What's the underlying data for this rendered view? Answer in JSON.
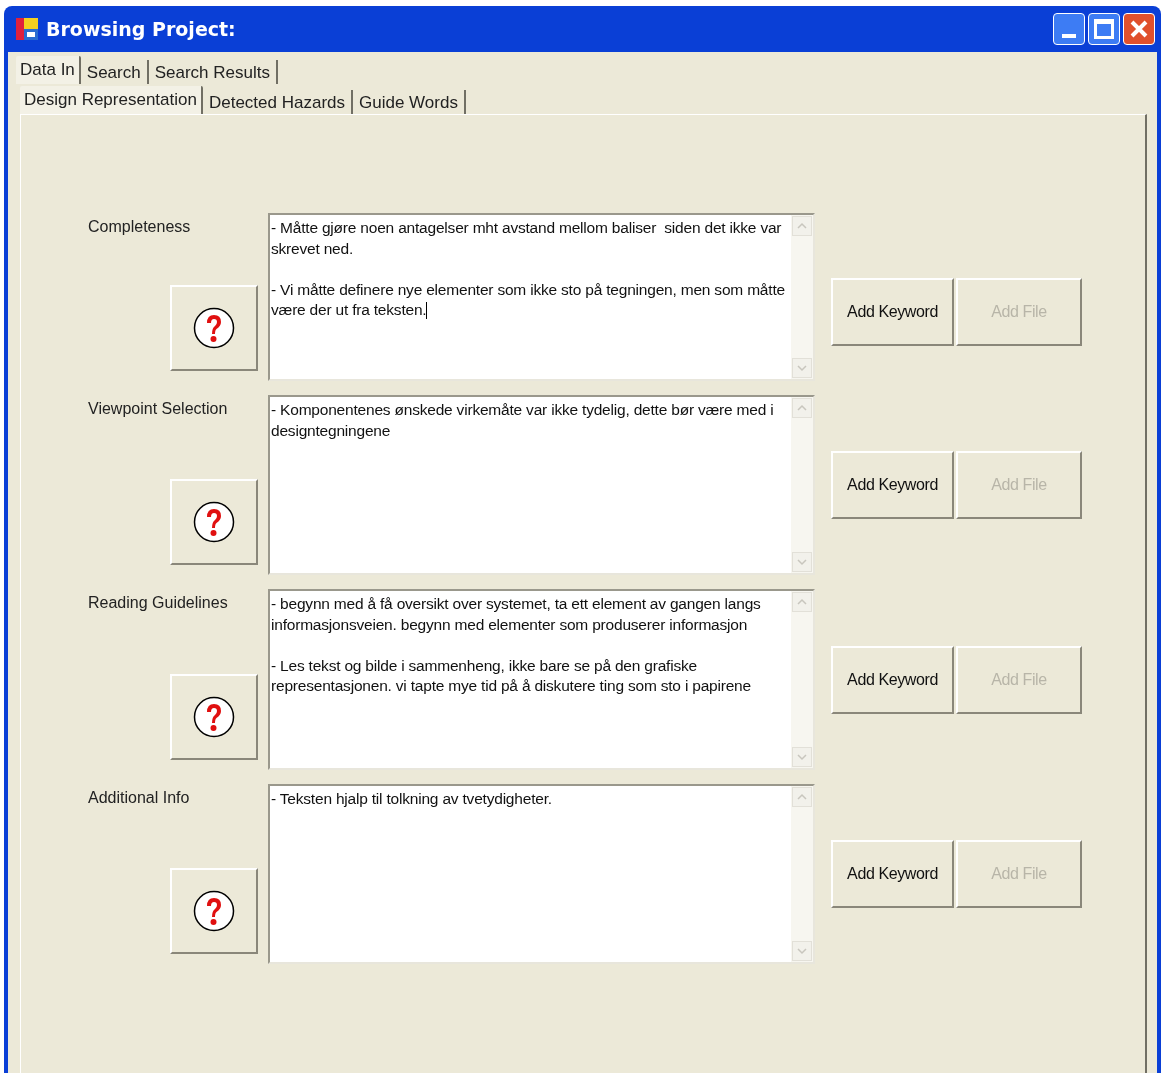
{
  "window": {
    "title": "Browsing Project:"
  },
  "tabs": [
    {
      "label": "Data In",
      "selected": true
    },
    {
      "label": "Search",
      "selected": false
    },
    {
      "label": "Search Results",
      "selected": false
    }
  ],
  "subtabs": [
    {
      "label": "Design Representation",
      "selected": true
    },
    {
      "label": "Detected Hazards",
      "selected": false
    },
    {
      "label": "Guide Words",
      "selected": false
    }
  ],
  "sections": [
    {
      "label": "Completeness",
      "text": "- Måtte gjøre noen antagelser mht avstand mellom baliser  siden det ikke var skrevet ned.\n\n- Vi måtte definere nye elementer som ikke sto på tegningen, men som måtte være der ut fra teksten.",
      "focused": true,
      "buttons": [
        {
          "label": "Add Keyword",
          "disabled": false
        },
        {
          "label": "Add File",
          "disabled": true
        }
      ]
    },
    {
      "label": "Viewpoint Selection",
      "text": "- Komponentenes ønskede virkemåte var ikke tydelig, dette bør være med i designtegningene",
      "focused": false,
      "buttons": [
        {
          "label": "Add Keyword",
          "disabled": false
        },
        {
          "label": "Add File",
          "disabled": true
        }
      ]
    },
    {
      "label": "Reading Guidelines",
      "text": "- begynn med å få oversikt over systemet, ta ett element av gangen langs informasjonsveien. begynn med elementer som produserer informasjon\n\n- Les tekst og bilde i sammenheng, ikke bare se på den grafiske representasjonen. vi tapte mye tid på å diskutere ting som sto i papirene",
      "focused": false,
      "buttons": [
        {
          "label": "Add Keyword",
          "disabled": false
        },
        {
          "label": "Add File",
          "disabled": true
        }
      ]
    },
    {
      "label": "Additional Info",
      "text": "- Teksten hjalp til tolkning av tvetydigheter.",
      "focused": false,
      "buttons": [
        {
          "label": "Add Keyword",
          "disabled": false
        },
        {
          "label": "Add File",
          "disabled": true
        }
      ]
    }
  ]
}
